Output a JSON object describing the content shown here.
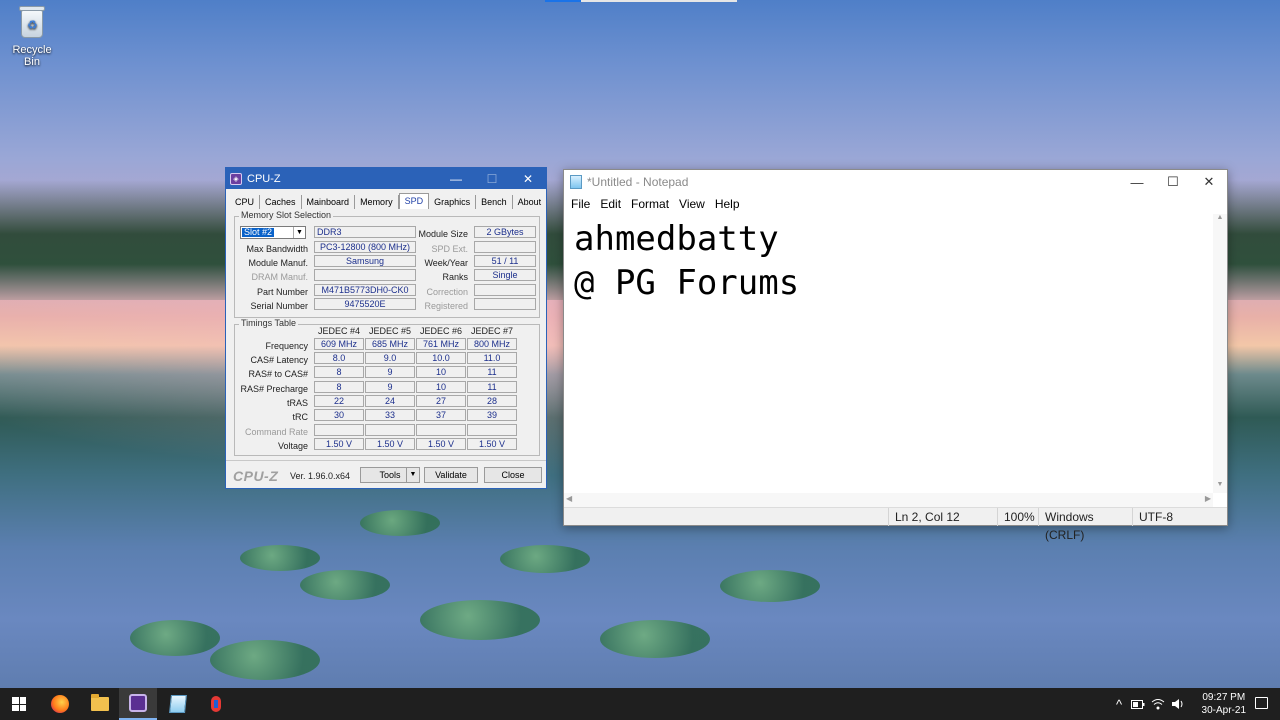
{
  "desktop": {
    "icons": [
      {
        "label": "Recycle Bin",
        "icon": "recycle-bin-icon"
      }
    ]
  },
  "cpuz": {
    "title": "CPU-Z",
    "tabs": [
      "CPU",
      "Caches",
      "Mainboard",
      "Memory",
      "SPD",
      "Graphics",
      "Bench",
      "About"
    ],
    "active_tab": "SPD",
    "memory_slot_selection": {
      "group_label": "Memory Slot Selection",
      "slot": "Slot #2",
      "type": "DDR3",
      "module_size_label": "Module Size",
      "module_size": "2 GBytes",
      "max_bandwidth_label": "Max Bandwidth",
      "max_bandwidth": "PC3-12800 (800 MHz)",
      "spd_ext_label": "SPD Ext.",
      "spd_ext": "",
      "module_manuf_label": "Module Manuf.",
      "module_manuf": "Samsung",
      "week_year_label": "Week/Year",
      "week_year": "51 / 11",
      "dram_manuf_label": "DRAM Manuf.",
      "dram_manuf": "",
      "ranks_label": "Ranks",
      "ranks": "Single",
      "part_number_label": "Part Number",
      "part_number": "M471B5773DH0-CK0",
      "correction_label": "Correction",
      "correction": "",
      "serial_number_label": "Serial Number",
      "serial_number": "9475520E",
      "registered_label": "Registered",
      "registered": ""
    },
    "timings": {
      "group_label": "Timings Table",
      "columns": [
        "JEDEC #4",
        "JEDEC #5",
        "JEDEC #6",
        "JEDEC #7"
      ],
      "rows": [
        {
          "label": "Frequency",
          "values": [
            "609 MHz",
            "685 MHz",
            "761 MHz",
            "800 MHz"
          ]
        },
        {
          "label": "CAS# Latency",
          "values": [
            "8.0",
            "9.0",
            "10.0",
            "11.0"
          ]
        },
        {
          "label": "RAS# to CAS#",
          "values": [
            "8",
            "9",
            "10",
            "11"
          ]
        },
        {
          "label": "RAS# Precharge",
          "values": [
            "8",
            "9",
            "10",
            "11"
          ]
        },
        {
          "label": "tRAS",
          "values": [
            "22",
            "24",
            "27",
            "28"
          ]
        },
        {
          "label": "tRC",
          "values": [
            "30",
            "33",
            "37",
            "39"
          ]
        },
        {
          "label": "Command Rate",
          "values": [
            "",
            "",
            "",
            ""
          ]
        },
        {
          "label": "Voltage",
          "values": [
            "1.50 V",
            "1.50 V",
            "1.50 V",
            "1.50 V"
          ]
        }
      ]
    },
    "footer": {
      "brand": "CPU-Z",
      "version": "Ver. 1.96.0.x64",
      "tools_label": "Tools",
      "validate_label": "Validate",
      "close_label": "Close"
    }
  },
  "notepad": {
    "title": "*Untitled - Notepad",
    "menu": [
      "File",
      "Edit",
      "Format",
      "View",
      "Help"
    ],
    "content_lines": [
      "ahmedbatty",
      "@ PG Forums"
    ],
    "status": {
      "position": "Ln 2, Col 12",
      "zoom": "100%",
      "line_endings": "Windows (CRLF)",
      "encoding": "UTF-8"
    }
  },
  "taskbar": {
    "clock_time": "09:27 PM",
    "clock_date": "30-Apr-21",
    "tray_chevron": "^",
    "apps": [
      "start-icon",
      "firefox-icon",
      "file-explorer-icon",
      "cpuz-icon",
      "notepad-icon",
      "app-icon"
    ]
  }
}
